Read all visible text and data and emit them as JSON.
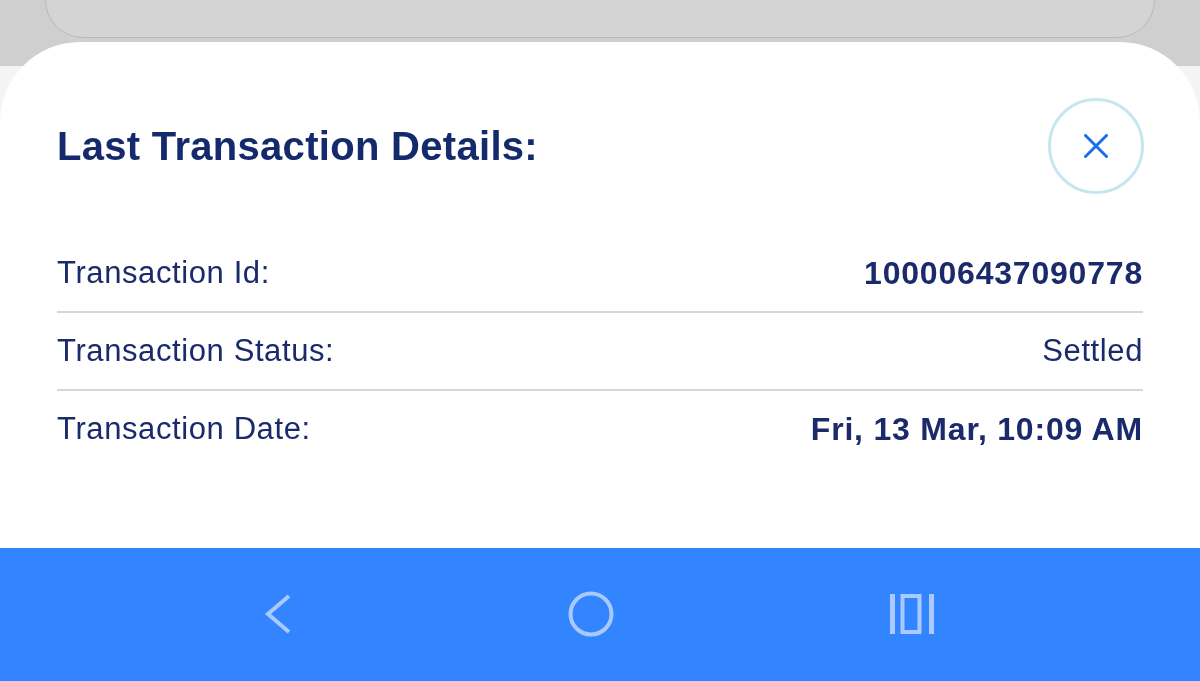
{
  "sheet": {
    "title": "Last Transaction Details:"
  },
  "details": [
    {
      "label": "Transaction Id:",
      "value": "100006437090778",
      "bold": true
    },
    {
      "label": "Transaction Status:",
      "value": "Settled",
      "bold": false
    },
    {
      "label": "Transaction Date:",
      "value": "Fri, 13 Mar, 10:09 AM",
      "bold": true
    }
  ],
  "nav_bar": {
    "buttons": [
      {
        "kind": "back"
      },
      {
        "kind": "home"
      },
      {
        "kind": "recents"
      }
    ]
  }
}
